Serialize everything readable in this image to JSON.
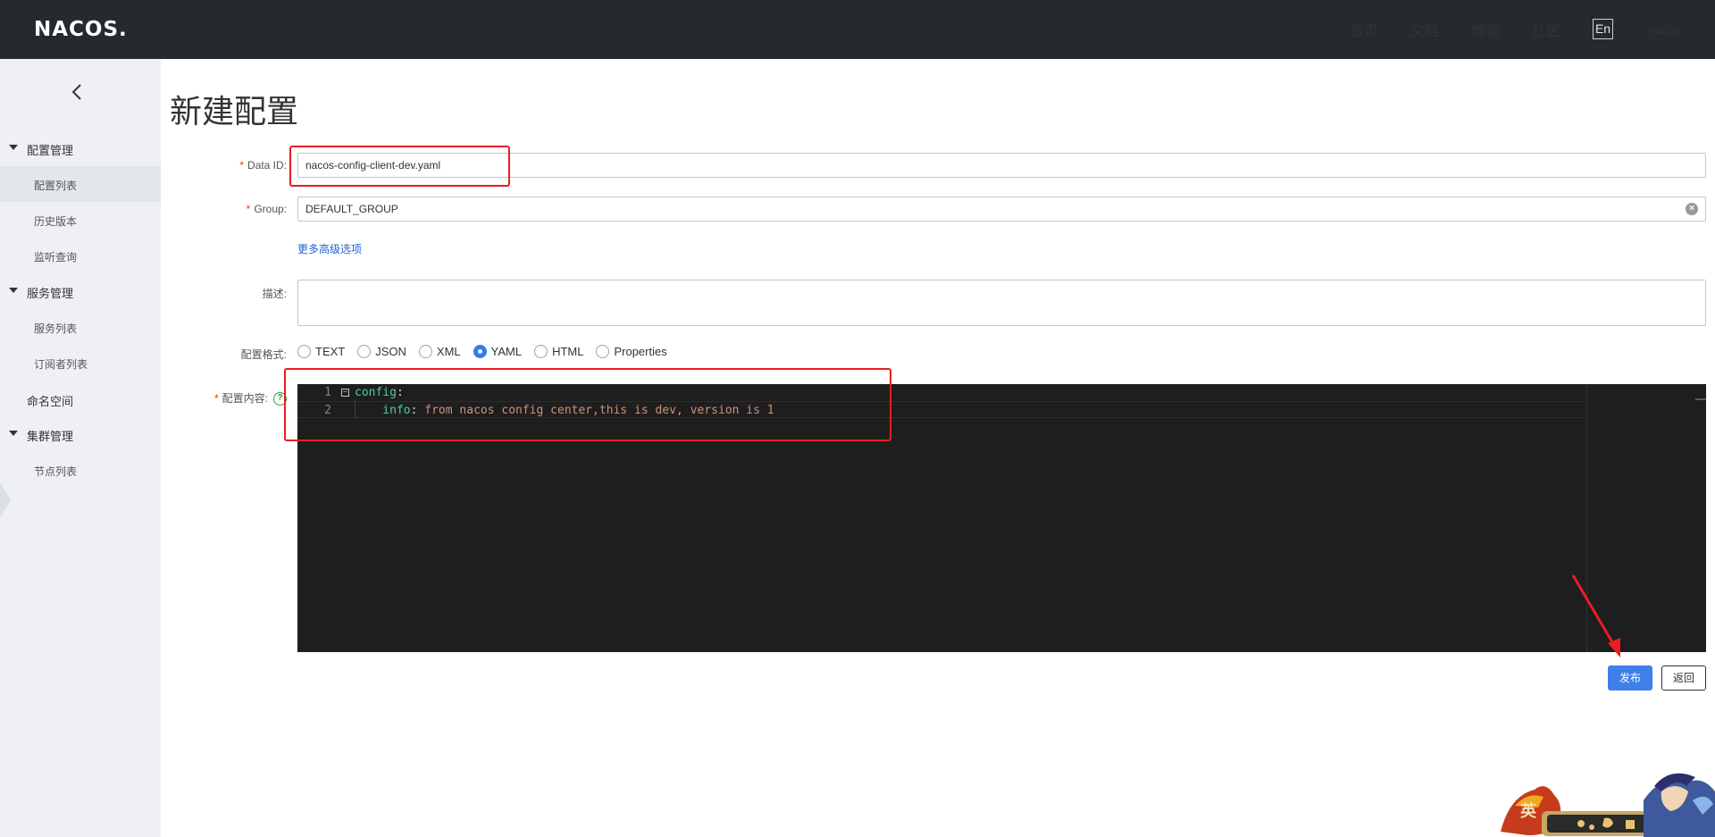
{
  "header": {
    "logo": "NACOS.",
    "nav": [
      "首页",
      "文档",
      "博客",
      "社区"
    ],
    "lang": "En",
    "user": "nacos"
  },
  "sidebar": {
    "groups": [
      {
        "label": "配置管理",
        "items": [
          "配置列表",
          "历史版本",
          "监听查询"
        ]
      },
      {
        "label": "服务管理",
        "items": [
          "服务列表",
          "订阅者列表"
        ]
      },
      {
        "plain": "命名空间"
      },
      {
        "label": "集群管理",
        "items": [
          "节点列表"
        ]
      }
    ]
  },
  "page": {
    "title": "新建配置"
  },
  "form": {
    "data_id_label": "Data ID:",
    "data_id_value": "nacos-config-client-dev.yaml",
    "group_label": "Group:",
    "group_value": "DEFAULT_GROUP",
    "advanced_link": "更多高级选项",
    "desc_label": "描述:",
    "format_label": "配置格式:",
    "formats": [
      "TEXT",
      "JSON",
      "XML",
      "YAML",
      "HTML",
      "Properties"
    ],
    "selected_format": "YAML",
    "content_label": "配置内容:",
    "required_mark": "*"
  },
  "editor": {
    "lines": [
      {
        "no": "1",
        "key": "config",
        "sep": ":",
        "value": ""
      },
      {
        "no": "2",
        "key": "    info",
        "sep": ":",
        "value": " from nacos config center,this is dev, version is 1"
      }
    ],
    "colors": {
      "background": "#1e1e1e",
      "key": "#4ec9b0",
      "value": "#ce9178"
    }
  },
  "actions": {
    "publish": "发布",
    "back": "返回"
  },
  "mascot_text": "英"
}
